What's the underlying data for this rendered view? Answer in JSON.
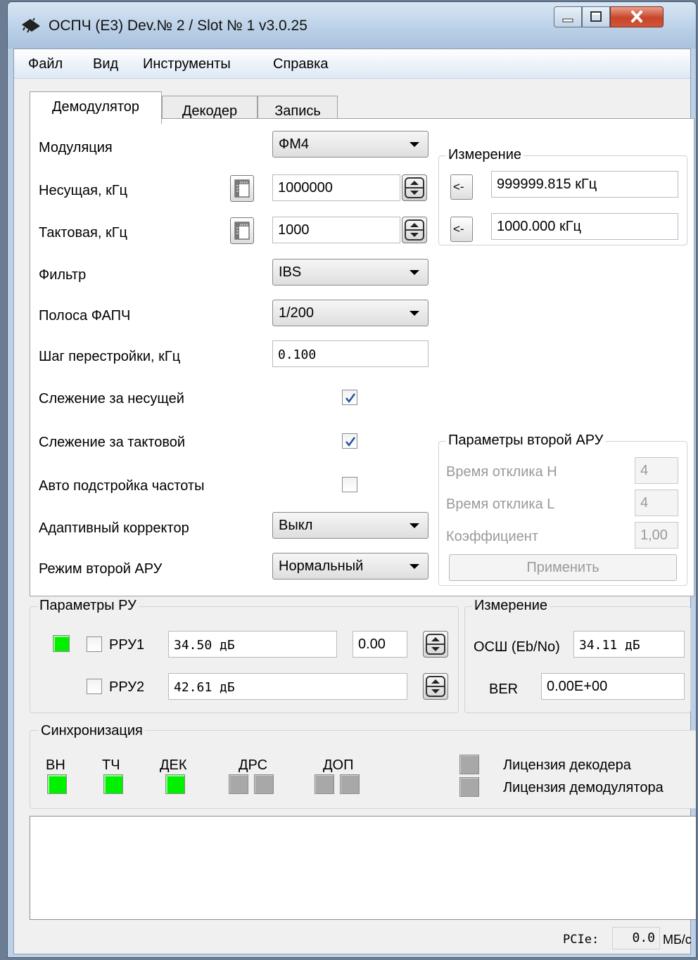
{
  "window": {
    "title": "ОСПЧ (Е3) Dev.№ 2 / Slot № 1 v3.0.25",
    "minimize": "minimize",
    "maximize": "maximize",
    "close": "close"
  },
  "menu": [
    "Файл",
    "Вид",
    "Инструменты",
    "Справка"
  ],
  "tabs": [
    {
      "label": "Демодулятор",
      "active": true
    },
    {
      "label": "Декодер",
      "active": false
    },
    {
      "label": "Запись",
      "active": false
    }
  ],
  "demod": {
    "modulation": {
      "label": "Модуляция",
      "value": "ФМ4"
    },
    "carrier": {
      "label": "Несущая, кГц",
      "value": "1000000"
    },
    "clock": {
      "label": "Тактовая, кГц",
      "value": "1000"
    },
    "filter": {
      "label": "Фильтр",
      "value": "IBS"
    },
    "pll_band": {
      "label": "Полоса ФАПЧ",
      "value": "1/200"
    },
    "tune_step": {
      "label": "Шаг перестройки, кГц",
      "value": "0.100"
    },
    "carrier_track": {
      "label": "Слежение за несущей",
      "checked": true
    },
    "clock_track": {
      "label": "Слежение за тактовой",
      "checked": true
    },
    "auto_freq": {
      "label": "Авто подстройка частоты",
      "checked": false
    },
    "adaptive_eq": {
      "label": "Адаптивный корректор",
      "value": "Выкл"
    },
    "agc2_mode": {
      "label": "Режим второй АРУ",
      "value": "Нормальный"
    }
  },
  "measure_top": {
    "title": "Измерение",
    "btn": "<-",
    "carrier_value": "999999.815 кГц",
    "clock_value": "1000.000 кГц"
  },
  "agc2_params": {
    "title": "Параметры  второй АРУ",
    "resp_h": {
      "label": "Время отклика Н",
      "value": "4"
    },
    "resp_l": {
      "label": "Время отклика L",
      "value": "4"
    },
    "coef": {
      "label": "Коэффициент",
      "value": "1,00"
    },
    "apply": "Применить"
  },
  "ru": {
    "title": "Параметры РУ",
    "rru1": {
      "label": "РРУ1",
      "value": "34.50 дБ",
      "value2": "0.00",
      "checked": false,
      "led": "on"
    },
    "rru2": {
      "label": "РРУ2",
      "value": "42.61 дБ",
      "checked": false
    }
  },
  "measure_bottom": {
    "title": "Измерение",
    "snr_label": "ОСШ (Eb/No)",
    "snr_value": "34.11 дБ",
    "ber_label": "BER",
    "ber_value": "0.00E+00"
  },
  "sync": {
    "title": "Синхронизация",
    "indicators": [
      {
        "label": "ВН",
        "state": "on"
      },
      {
        "label": "ТЧ",
        "state": "on"
      },
      {
        "label": "ДЕК",
        "state": "on"
      },
      {
        "label": "ДРС",
        "state": "off"
      },
      {
        "label": "ДОП",
        "state": "off"
      }
    ],
    "license_decoder": "Лицензия декодера",
    "license_demod": "Лицензия демодулятора"
  },
  "status": {
    "pcie_label": "PCIe:",
    "pcie_value": "0.0",
    "pcie_unit": "МБ/с"
  },
  "colors": {
    "led_on": "#00f000",
    "led_off": "#a8a8a8",
    "check_mark": "#2a4fa8"
  }
}
